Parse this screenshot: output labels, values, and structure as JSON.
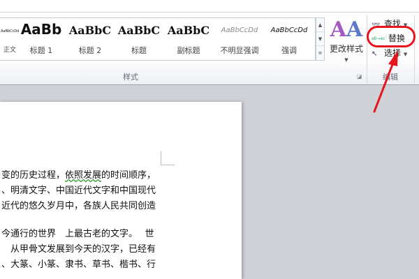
{
  "styles_gallery": [
    {
      "preview": "AaBbCcDd",
      "label": "正文"
    },
    {
      "preview": "AaBb",
      "label": "标题 1"
    },
    {
      "preview": "AaBbC",
      "label": "标题 2"
    },
    {
      "preview": "AaBbC",
      "label": "标题"
    },
    {
      "preview": "AaBbC",
      "label": "副标题"
    },
    {
      "preview": "AaBbCcDd",
      "label": "不明显强调"
    },
    {
      "preview": "AaBbCcDd",
      "label": "强调"
    }
  ],
  "change_styles": {
    "label": "更改样式"
  },
  "groups": {
    "styles": "样式",
    "editing": "编辑"
  },
  "editing": {
    "find": "查找",
    "replace": "替换",
    "select": "选择",
    "replace_icon_text": "ab→ac"
  },
  "document": {
    "lines": [
      "变的历史过程，",
      "依照发展",
      "的时间顺序，",
      "、明清文字、中国近代文字和中国现代",
      "近代的悠久岁月中，各族人民共同创造",
      "今通行的世界　上最古老的文字。　 世",
      "　从甲骨文发展到今天的汉字，已经有",
      "、大篆、小篆、隶书、草书、楷书、行"
    ]
  },
  "annotation_color": "#e8141c"
}
